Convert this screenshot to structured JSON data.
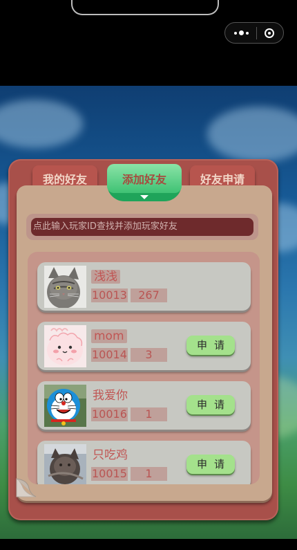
{
  "tabs": {
    "my_friends": "我的好友",
    "add_friend": "添加好友",
    "friend_requests": "好友申请"
  },
  "search": {
    "placeholder": "点此输入玩家ID查找并添加玩家好友"
  },
  "players": [
    {
      "name": "浅浅",
      "id": "10013",
      "level": "267",
      "show_apply": false,
      "avatar": "gray-cat"
    },
    {
      "name": "mom",
      "id": "10014",
      "level": "3",
      "show_apply": true,
      "avatar": "pink-cartoon"
    },
    {
      "name": "我爱你",
      "id": "10016",
      "level": "1",
      "show_apply": true,
      "avatar": "doraemon"
    },
    {
      "name": "只吃鸡",
      "id": "10015",
      "level": "1",
      "show_apply": true,
      "avatar": "dark-cat"
    }
  ],
  "apply_label": "申请",
  "colors": {
    "panel": "#a8504a",
    "active_tab": "#3fc274",
    "apply_button": "#a4e18c"
  }
}
